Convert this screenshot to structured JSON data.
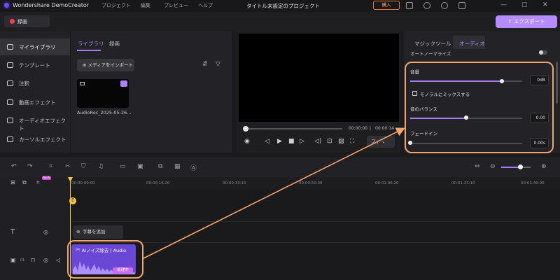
{
  "app": {
    "name": "Wondershare DemoCreator",
    "menu": [
      "プロジェクト",
      "編集",
      "プレビュー",
      "ヘルプ"
    ],
    "project_title": "タイトル未設定のプロジェクト",
    "buy_label": "購入"
  },
  "toolbar": {
    "record_label": "録画",
    "export_label": "エクスポート"
  },
  "left_nav": {
    "items": [
      {
        "label": "マイライブラリ",
        "icon": "layers-icon"
      },
      {
        "label": "テンプレート",
        "icon": "template-icon"
      },
      {
        "label": "注釈",
        "icon": "annotation-icon"
      },
      {
        "label": "動画エフェクト",
        "icon": "video-effect-icon"
      },
      {
        "label": "オーディオエフェクト",
        "icon": "music-icon"
      },
      {
        "label": "カーソルエフェクト",
        "icon": "cursor-icon"
      }
    ]
  },
  "media": {
    "tabs": [
      "ライブラリ",
      "録画"
    ],
    "import_label": "メディアをインポート",
    "file_name": "AudioRec_2025-05-26..."
  },
  "preview": {
    "time_current": "00:00:00",
    "time_total": "00:00:14",
    "fit_label": "フィ"
  },
  "properties": {
    "tabs": [
      "マジックツール",
      "オーディオ"
    ],
    "normalize_label": "オートノーマライズ",
    "volume_label": "音量",
    "volume_value": "0dB",
    "volume_level": 0.82,
    "mono_label": "モノラルにミックスする",
    "balance_label": "音のバランス",
    "balance_value": "0.00",
    "balance_level": 0.5,
    "fadein_label": "フェードイン",
    "fadein_value": "0.00s",
    "fadein_level": 0.0
  },
  "timeline": {
    "ruler": [
      "00:00:00:00",
      "00:00:16:20",
      "00:00:33:10",
      "00:00:50:00",
      "00:01:06:20",
      "00:01:23:10",
      "00:01:40:00"
    ],
    "new_badge": "NEW",
    "subtitle_button": "字幕を追加",
    "clip_label": "AIノイズ除去",
    "clip_source": "Audio",
    "clip_status": "処理中",
    "track_number": "01",
    "zoom_level": 0.62
  },
  "colors": {
    "accent": "#a77bff",
    "highlight": "#f3a46b",
    "playhead": "#f6c945"
  }
}
